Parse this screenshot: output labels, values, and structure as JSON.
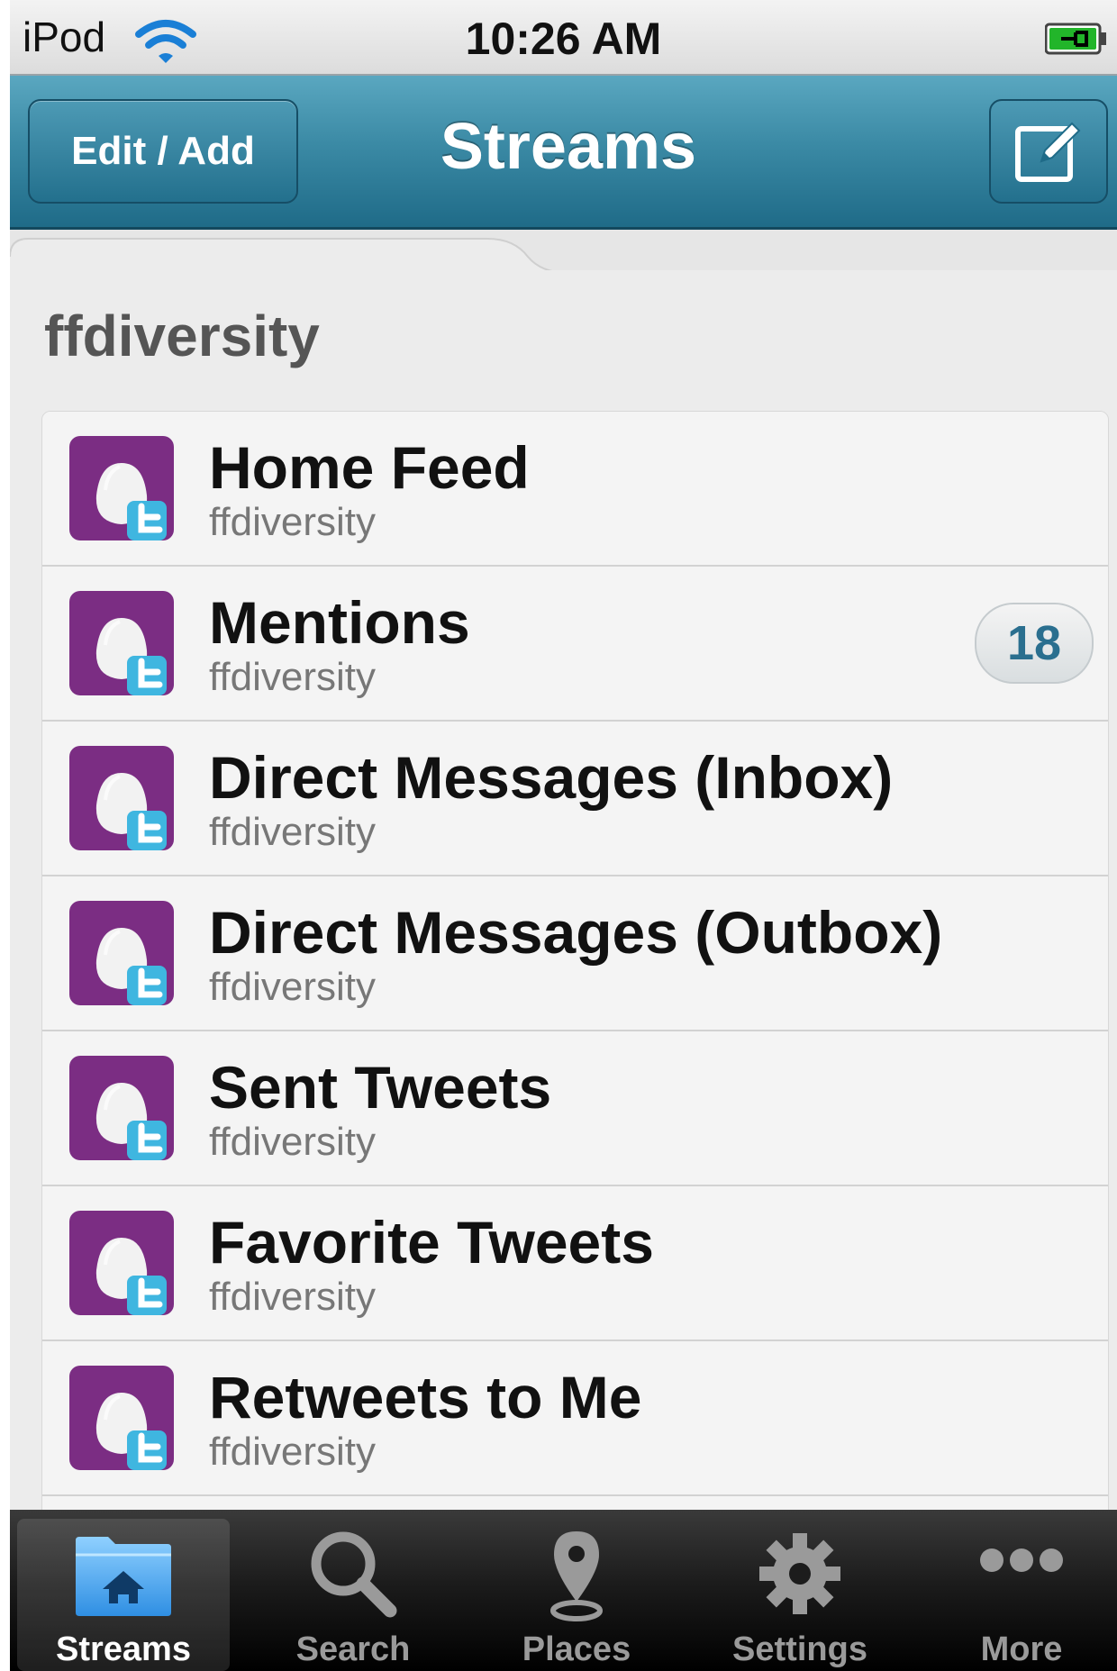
{
  "status_bar": {
    "carrier": "iPod",
    "time": "10:26 AM"
  },
  "nav": {
    "left_button": "Edit / Add",
    "title": "Streams",
    "right_icon": "compose-icon"
  },
  "section": {
    "title": "ffdiversity"
  },
  "streams": [
    {
      "title": "Home Feed",
      "account": "ffdiversity",
      "badge": ""
    },
    {
      "title": "Mentions",
      "account": "ffdiversity",
      "badge": "18"
    },
    {
      "title": "Direct Messages (Inbox)",
      "account": "ffdiversity",
      "badge": ""
    },
    {
      "title": "Direct Messages (Outbox)",
      "account": "ffdiversity",
      "badge": ""
    },
    {
      "title": "Sent Tweets",
      "account": "ffdiversity",
      "badge": ""
    },
    {
      "title": "Favorite Tweets",
      "account": "ffdiversity",
      "badge": ""
    },
    {
      "title": "Retweets to Me",
      "account": "ffdiversity",
      "badge": ""
    }
  ],
  "tabbar": {
    "selected": "Streams",
    "tabs": [
      {
        "label": "Streams",
        "icon": "folder-home-icon"
      },
      {
        "label": "Search",
        "icon": "magnifier-icon"
      },
      {
        "label": "Places",
        "icon": "map-pin-icon"
      },
      {
        "label": "Settings",
        "icon": "gear-icon"
      },
      {
        "label": "More",
        "icon": "more-dots-icon"
      }
    ]
  },
  "colors": {
    "nav_bar": "#3b8aa5",
    "avatar_purple": "#7b2d83",
    "twitter_blue": "#3fb6e0",
    "badge_text": "#2a6f8f"
  }
}
